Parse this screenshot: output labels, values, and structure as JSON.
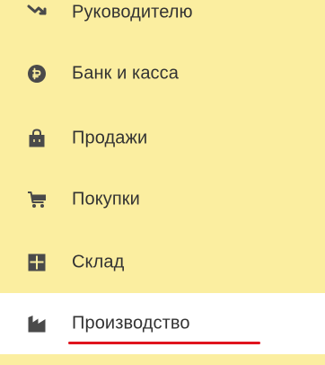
{
  "menu": {
    "items": [
      {
        "label": "Руководителю",
        "icon": "manager-icon"
      },
      {
        "label": "Банк и касса",
        "icon": "ruble-coin-icon"
      },
      {
        "label": "Продажи",
        "icon": "shopping-bag-icon"
      },
      {
        "label": "Покупки",
        "icon": "shopping-cart-icon"
      },
      {
        "label": "Склад",
        "icon": "warehouse-grid-icon"
      },
      {
        "label": "Производство",
        "icon": "factory-icon"
      }
    ],
    "active_index": 5
  },
  "colors": {
    "menu_background": "#fbeea0",
    "active_background": "#ffffff",
    "icon_color": "#4a4a4a",
    "text_color": "#333333",
    "underline_color": "#e0141e"
  }
}
